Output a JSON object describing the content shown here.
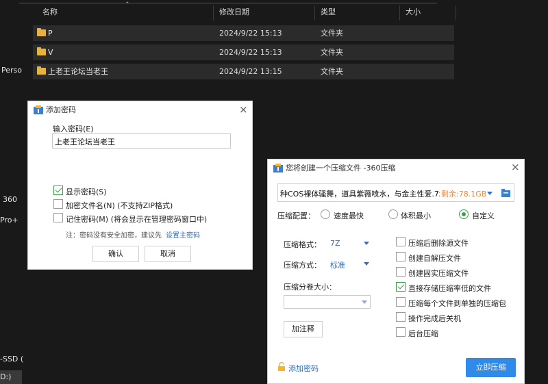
{
  "explorer": {
    "columns": {
      "name": "名称",
      "date": "修改日期",
      "type": "类型",
      "size": "大小"
    },
    "rows": [
      {
        "name": "P",
        "date": "2024/9/22 15:13",
        "type": "文件夹"
      },
      {
        "name": "V",
        "date": "2024/9/22 15:13",
        "type": "文件夹"
      },
      {
        "name": "上老王论坛当老王",
        "date": "2024/9/22 13:15",
        "type": "文件夹"
      }
    ],
    "sidebar": {
      "item1": "Perso",
      "item2": "360",
      "item3": "Pro+",
      "item4": "-SSD (",
      "item5": "D:)"
    }
  },
  "password_dialog": {
    "title": "添加密码",
    "input_label": "输入密码(E)",
    "input_value": "上老王论坛当老王",
    "show_password": "显示密码(S)",
    "encrypt_names": "加密文件名(N) (不支持ZIP格式)",
    "remember": "记住密码(M) (将会显示在管理密码窗口中)",
    "note": "注：密码没有安全加密，建议先",
    "note_link": "设置主密码",
    "ok": "确认",
    "cancel": "取消"
  },
  "compress_dialog": {
    "title": "您将创建一个压缩文件 -360压缩",
    "path": "种COS裸体骚舞，道具紫薇喷水，与金主性爱.7z",
    "free_space": "剩余:78.1GB",
    "config_label": "压缩配置：",
    "opt_fast": "速度最快",
    "opt_small": "体积最小",
    "opt_custom": "自定义",
    "format_label": "压缩格式：",
    "format_value": "7Z",
    "method_label": "压缩方式：",
    "method_value": "标准",
    "split_label": "压缩分卷大小：",
    "comment_btn": "加注释",
    "options": [
      "压缩后删除源文件",
      "创建自解压文件",
      "创建固实压缩文件",
      "直接存储压缩率低的文件",
      "压缩每个文件到单独的压缩包",
      "操作完成后关机",
      "后台压缩"
    ],
    "add_password": "添加密码",
    "start": "立即压缩"
  },
  "colors": {
    "accent": "#2f6fc9",
    "green": "#3aa24a",
    "orange": "#f0883a",
    "folder": "#e8b23f"
  }
}
